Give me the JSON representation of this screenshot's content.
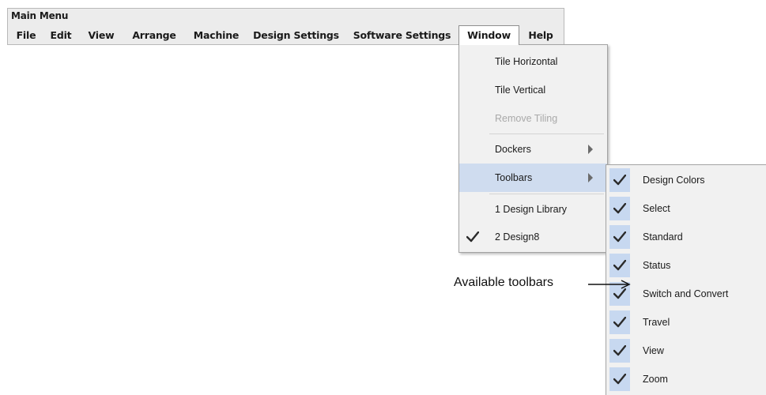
{
  "menubar": {
    "title": "Main Menu",
    "items": [
      {
        "label": "File"
      },
      {
        "label": "Edit"
      },
      {
        "label": "View"
      },
      {
        "label": "Arrange"
      },
      {
        "label": "Machine"
      },
      {
        "label": "Design Settings"
      },
      {
        "label": "Software Settings"
      },
      {
        "label": "Window",
        "active": true
      },
      {
        "label": "Help"
      }
    ]
  },
  "window_menu": {
    "items": [
      {
        "label": "Tile Horizontal"
      },
      {
        "label": "Tile Vertical"
      },
      {
        "label": "Remove Tiling",
        "disabled": true
      },
      {
        "label": "Dockers",
        "submenu": true
      },
      {
        "label": "Toolbars",
        "submenu": true,
        "highlighted": true
      },
      {
        "label": "1 Design Library"
      },
      {
        "label": "2 Design8",
        "checked": true
      }
    ]
  },
  "toolbars_menu": {
    "items": [
      {
        "label": "Design Colors",
        "checked": true
      },
      {
        "label": "Select",
        "checked": true
      },
      {
        "label": "Standard",
        "checked": true
      },
      {
        "label": "Status",
        "checked": true
      },
      {
        "label": "Switch and Convert",
        "checked": true
      },
      {
        "label": "Travel",
        "checked": true
      },
      {
        "label": "View",
        "checked": true
      },
      {
        "label": "Zoom",
        "checked": true
      }
    ]
  },
  "annotation": {
    "text": "Available toolbars"
  },
  "colors": {
    "menubar_bg": "#ececec",
    "menu_bg": "#f1f1f1",
    "highlight": "#cfdcef",
    "check_bg": "#c7d8f0",
    "disabled_text": "#a9a9a9"
  }
}
